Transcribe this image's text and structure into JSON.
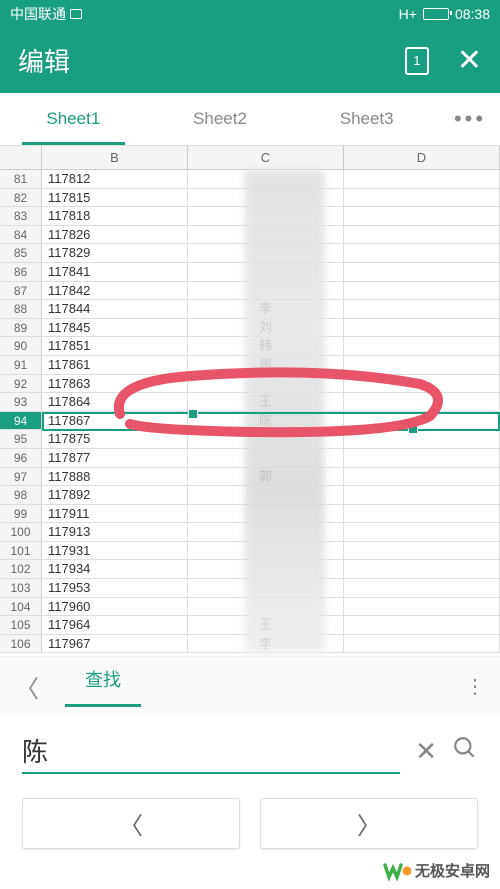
{
  "status": {
    "carrier": "中国联通",
    "network": "H+",
    "time": "08:38"
  },
  "header": {
    "title": "编辑",
    "doc_badge": "1"
  },
  "tabs": {
    "items": [
      "Sheet1",
      "Sheet2",
      "Sheet3"
    ],
    "active_index": 0
  },
  "columns": [
    "B",
    "C",
    "D"
  ],
  "selected_row": 94,
  "rows": [
    {
      "n": 81,
      "b": "117812",
      "c": ""
    },
    {
      "n": 82,
      "b": "117815",
      "c": ""
    },
    {
      "n": 83,
      "b": "117818",
      "c": ""
    },
    {
      "n": 84,
      "b": "117826",
      "c": ""
    },
    {
      "n": 85,
      "b": "117829",
      "c": ""
    },
    {
      "n": 86,
      "b": "117841",
      "c": ""
    },
    {
      "n": 87,
      "b": "117842",
      "c": ""
    },
    {
      "n": 88,
      "b": "117844",
      "c": "李"
    },
    {
      "n": 89,
      "b": "117845",
      "c": "刘"
    },
    {
      "n": 90,
      "b": "117851",
      "c": "韩"
    },
    {
      "n": 91,
      "b": "117861",
      "c": "周"
    },
    {
      "n": 92,
      "b": "117863",
      "c": ""
    },
    {
      "n": 93,
      "b": "117864",
      "c": "王"
    },
    {
      "n": 94,
      "b": "117867",
      "c": "陈"
    },
    {
      "n": 95,
      "b": "117875",
      "c": ""
    },
    {
      "n": 96,
      "b": "117877",
      "c": ""
    },
    {
      "n": 97,
      "b": "117888",
      "c": "郭"
    },
    {
      "n": 98,
      "b": "117892",
      "c": ""
    },
    {
      "n": 99,
      "b": "117911",
      "c": ""
    },
    {
      "n": 100,
      "b": "117913",
      "c": ""
    },
    {
      "n": 101,
      "b": "117931",
      "c": ""
    },
    {
      "n": 102,
      "b": "117934",
      "c": ""
    },
    {
      "n": 103,
      "b": "117953",
      "c": ""
    },
    {
      "n": 104,
      "b": "117960",
      "c": ""
    },
    {
      "n": 105,
      "b": "117964",
      "c": "王"
    },
    {
      "n": 106,
      "b": "117967",
      "c": "李"
    }
  ],
  "find": {
    "label": "查找",
    "value": "陈"
  },
  "watermark": "无极安卓网"
}
